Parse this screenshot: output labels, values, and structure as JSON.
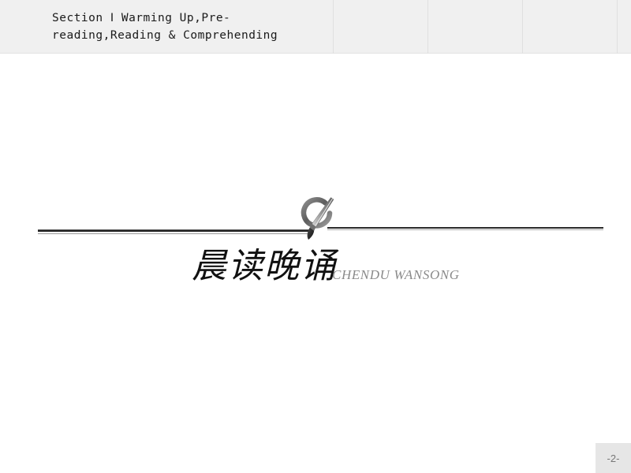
{
  "slide": {
    "background_color": "#ffffff",
    "header": {
      "background_color": "#f0f0f0",
      "title": "Section Ⅰ  Warming Up,Pre-\nreading,Reading & Comprehending",
      "divider_positions": [
        422,
        542,
        662,
        782
      ]
    },
    "emblem": {
      "icon_name": "brush-in-circle-emblem",
      "description": "gray ring with calligraphy brush diagonal",
      "ring_color": "#6e6e6e",
      "brush_color": "#4a4a4a"
    },
    "rules": {
      "left_color": "#222222",
      "right_color": "#2b2b2b"
    },
    "title": {
      "chinese": "晨读晚诵",
      "pinyin": "CHENDU WANSONG",
      "chinese_color": "#111111",
      "pinyin_color": "#8a8a8a"
    },
    "page_badge": {
      "label": "-2-",
      "background_color": "#e6e6e6",
      "text_color": "#777777"
    }
  }
}
